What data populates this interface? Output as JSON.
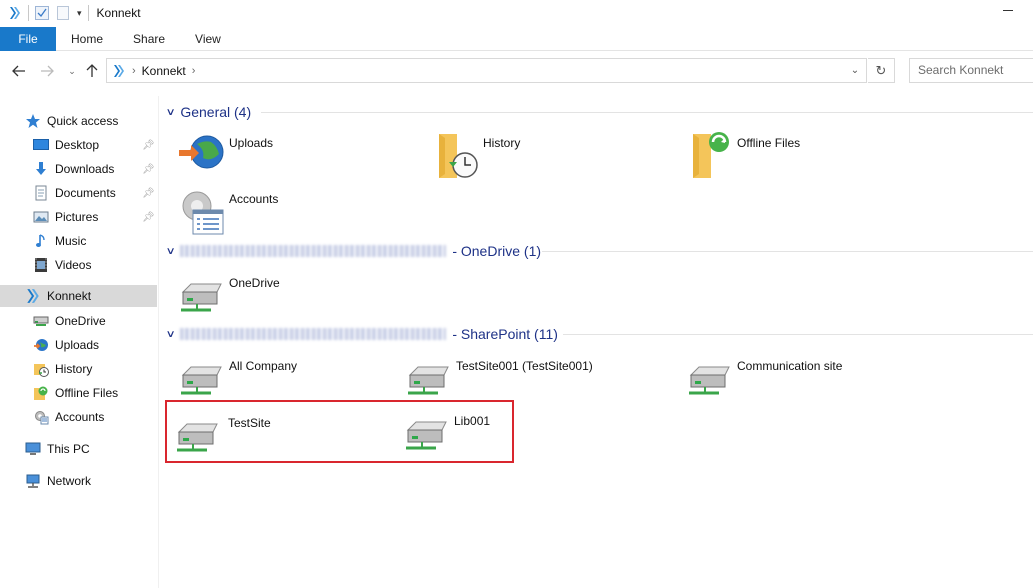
{
  "window": {
    "title": "Konnekt"
  },
  "ribbon": {
    "tabs": [
      "File",
      "Home",
      "Share",
      "View"
    ]
  },
  "address": {
    "breadcrumb": [
      "Konnekt"
    ],
    "search_placeholder": "Search Konnekt"
  },
  "sidebar": {
    "quick_access": "Quick access",
    "quick_items": [
      {
        "label": "Desktop",
        "pinned": true,
        "icon": "desktop-icon"
      },
      {
        "label": "Downloads",
        "pinned": true,
        "icon": "downloads-icon"
      },
      {
        "label": "Documents",
        "pinned": true,
        "icon": "documents-icon"
      },
      {
        "label": "Pictures",
        "pinned": true,
        "icon": "pictures-icon"
      },
      {
        "label": "Music",
        "pinned": false,
        "icon": "music-icon"
      },
      {
        "label": "Videos",
        "pinned": false,
        "icon": "videos-icon"
      }
    ],
    "konnekt": "Konnekt",
    "konnekt_items": [
      {
        "label": "OneDrive",
        "icon": "drive-icon"
      },
      {
        "label": "Uploads",
        "icon": "globe-icon"
      },
      {
        "label": "History",
        "icon": "history-icon"
      },
      {
        "label": "Offline Files",
        "icon": "offline-icon"
      },
      {
        "label": "Accounts",
        "icon": "gear-icon"
      }
    ],
    "this_pc": "This PC",
    "network": "Network"
  },
  "groups": [
    {
      "header": "General (4)",
      "items": [
        {
          "label": "Uploads",
          "icon": "globe-upload-icon"
        },
        {
          "label": "History",
          "icon": "folder-history-icon"
        },
        {
          "label": "Offline Files",
          "icon": "folder-sync-icon"
        },
        {
          "label": "Accounts",
          "icon": "settings-list-icon"
        }
      ]
    },
    {
      "header": "- OneDrive (1)",
      "items": [
        {
          "label": "OneDrive",
          "icon": "network-drive-icon"
        }
      ]
    },
    {
      "header": "- SharePoint (11)",
      "items": [
        {
          "label": "All Company",
          "icon": "network-drive-icon"
        },
        {
          "label": "TestSite001 (TestSite001)",
          "icon": "network-drive-icon"
        },
        {
          "label": "Communication site",
          "icon": "network-drive-icon"
        },
        {
          "label": "TestSite",
          "icon": "network-drive-icon"
        },
        {
          "label": "Lib001",
          "icon": "network-drive-icon"
        }
      ]
    }
  ],
  "colors": {
    "accent": "#1979ca",
    "group_header": "#1e3287",
    "highlight_border": "#d9262e"
  }
}
